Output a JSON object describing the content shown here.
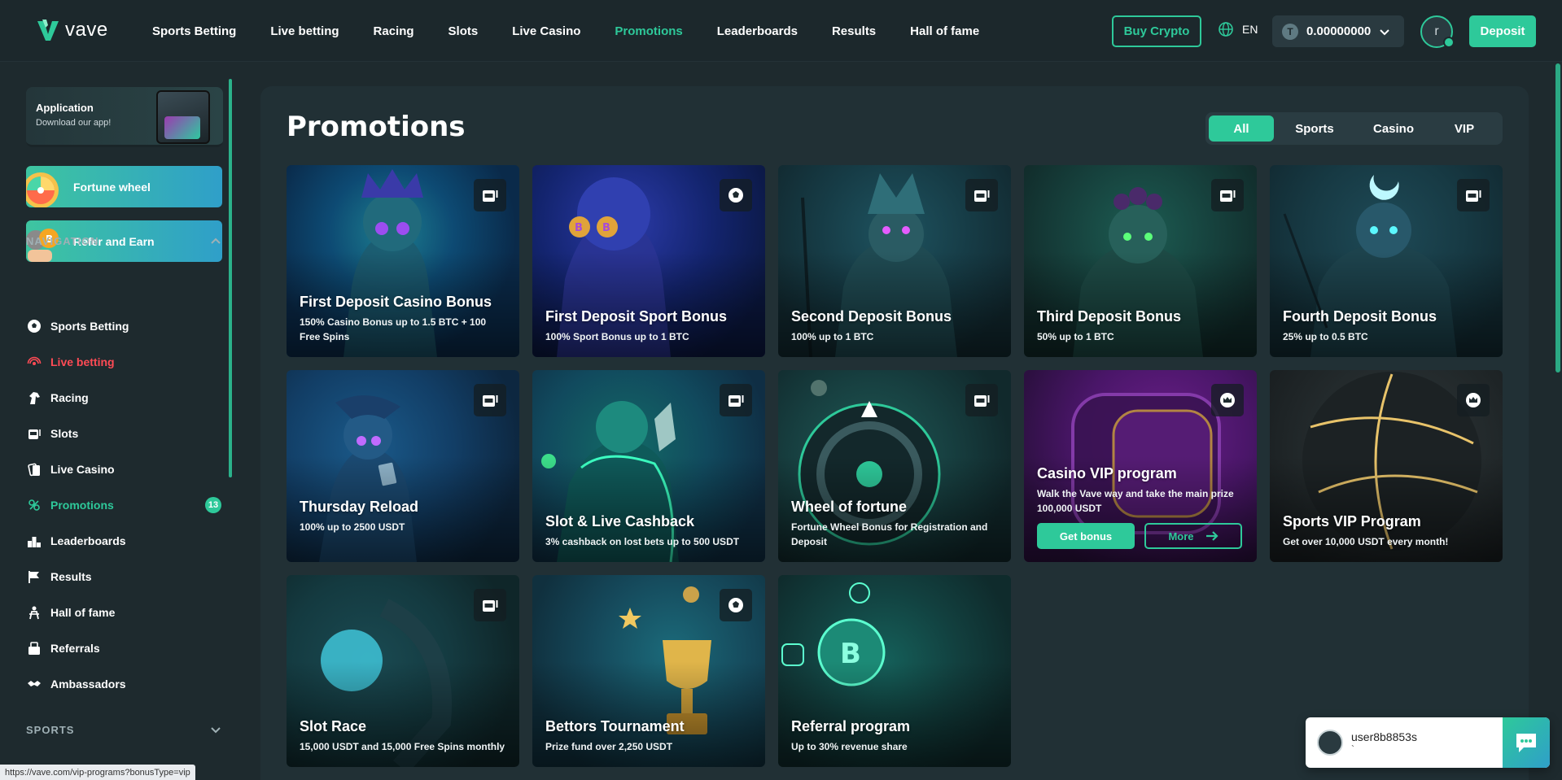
{
  "header": {
    "logo_text": "vave",
    "nav": [
      "Sports Betting",
      "Live betting",
      "Racing",
      "Slots",
      "Live Casino",
      "Promotions",
      "Leaderboards",
      "Results",
      "Hall of fame"
    ],
    "active_nav": "Promotions",
    "buy_crypto": "Buy Crypto",
    "language": "EN",
    "balance": "0.00000000",
    "coin_symbol": "T",
    "avatar_letter": "r",
    "deposit": "Deposit"
  },
  "sidebar": {
    "app_title": "Application",
    "app_subtitle": "Download our app!",
    "fortune_wheel": "Fortune wheel",
    "refer_earn": "Refer and Earn",
    "navigation_title": "NAVIGATION",
    "items": [
      {
        "label": "Sports Betting",
        "icon": "soccer-ball-icon"
      },
      {
        "label": "Live betting",
        "icon": "live-signal-icon"
      },
      {
        "label": "Racing",
        "icon": "horse-icon"
      },
      {
        "label": "Slots",
        "icon": "slot-machine-icon"
      },
      {
        "label": "Live Casino",
        "icon": "cards-icon"
      },
      {
        "label": "Promotions",
        "icon": "promotions-icon",
        "badge": "13"
      },
      {
        "label": "Leaderboards",
        "icon": "leaderboard-icon"
      },
      {
        "label": "Results",
        "icon": "flag-icon"
      },
      {
        "label": "Hall of fame",
        "icon": "hall-of-fame-icon"
      },
      {
        "label": "Referrals",
        "icon": "referrals-icon"
      },
      {
        "label": "Ambassadors",
        "icon": "handshake-icon"
      }
    ],
    "sports_title": "SPORTS",
    "status_url": "https://vave.com/vip-programs?bonusType=vip"
  },
  "main": {
    "title": "Promotions",
    "filters": [
      "All",
      "Sports",
      "Casino",
      "VIP"
    ],
    "active_filter": "All",
    "cards": [
      {
        "title": "First Deposit Casino Bonus",
        "subtitle": "150% Casino Bonus up to 1.5 BTC + 100 Free Spins",
        "tag": "slot-machine-icon"
      },
      {
        "title": "First Deposit Sport Bonus",
        "subtitle": "100% Sport Bonus up to 1 BTC",
        "tag": "soccer-ball-icon"
      },
      {
        "title": "Second Deposit Bonus",
        "subtitle": "100% up to 1 BTC",
        "tag": "slot-machine-icon"
      },
      {
        "title": "Third Deposit Bonus",
        "subtitle": "50% up to 1 BTC",
        "tag": "slot-machine-icon"
      },
      {
        "title": "Fourth Deposit Bonus",
        "subtitle": "25% up to 0.5 BTC",
        "tag": "slot-machine-icon"
      },
      {
        "title": "Thursday Reload",
        "subtitle": "100% up to 2500 USDT",
        "tag": "slot-machine-icon"
      },
      {
        "title": "Slot & Live Cashback",
        "subtitle": "3% cashback on lost bets up to 500 USDT",
        "tag": "slot-machine-icon"
      },
      {
        "title": "Wheel of fortune",
        "subtitle": "Fortune Wheel Bonus for Registration and Deposit",
        "tag": "slot-machine-icon"
      },
      {
        "title": "Casino VIP program",
        "subtitle": "Walk the Vave way and take the main prize",
        "highlight": "100,000 USDT",
        "tag": "crown-icon",
        "get_bonus": "Get bonus",
        "more": "More"
      },
      {
        "title": "Sports VIP Program",
        "subtitle_pre": "Get over ",
        "subtitle_strong": "10,000 USDT",
        "subtitle_post": " every month!",
        "tag": "crown-icon"
      },
      {
        "title": "Slot Race",
        "subtitle": "15,000 USDT and 15,000 Free Spins monthly",
        "tag": "slot-machine-icon"
      },
      {
        "title": "Bettors Tournament",
        "subtitle": "Prize fund over 2,250 USDT",
        "tag": "soccer-ball-icon"
      },
      {
        "title": "Referral program",
        "subtitle": "Up to 30% revenue share"
      }
    ]
  },
  "chat": {
    "user": "user8b8853s",
    "message": "`"
  },
  "colors": {
    "accent": "#2ec99a",
    "live": "#ff4b55",
    "background": "#1e2a2e"
  }
}
